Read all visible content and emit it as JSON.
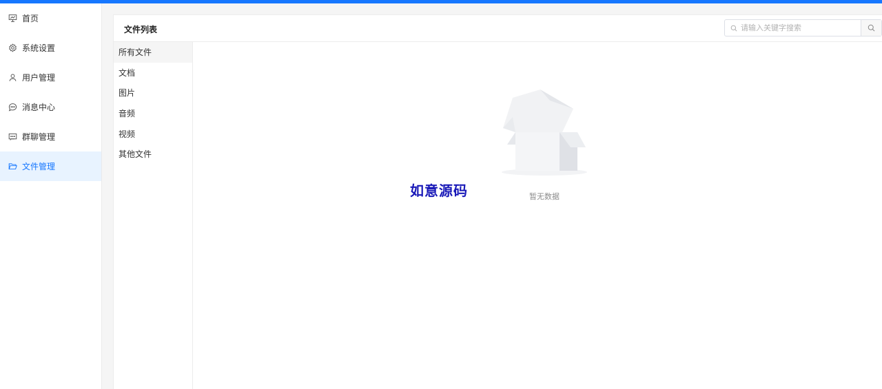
{
  "colors": {
    "accent": "#1677ff",
    "active_bg": "#e8f3ff",
    "watermark": "#1a1ab8"
  },
  "sidebar": {
    "items": [
      {
        "label": "首页",
        "icon": "presentation-icon"
      },
      {
        "label": "系统设置",
        "icon": "gear-icon"
      },
      {
        "label": "用户管理",
        "icon": "user-icon"
      },
      {
        "label": "消息中心",
        "icon": "chat-bubble-icon"
      },
      {
        "label": "群聊管理",
        "icon": "group-chat-icon"
      },
      {
        "label": "文件管理",
        "icon": "folder-open-icon",
        "active": true
      }
    ]
  },
  "panel": {
    "title": "文件列表",
    "search": {
      "placeholder": "请输入关键字搜索",
      "value": ""
    }
  },
  "categories": [
    {
      "label": "所有文件",
      "active": true
    },
    {
      "label": "文档"
    },
    {
      "label": "图片"
    },
    {
      "label": "音频"
    },
    {
      "label": "视频"
    },
    {
      "label": "其他文件"
    }
  ],
  "empty_state": {
    "text": "暂无数据",
    "icon": "empty-box-icon"
  },
  "watermark": {
    "text": "如意源码"
  }
}
